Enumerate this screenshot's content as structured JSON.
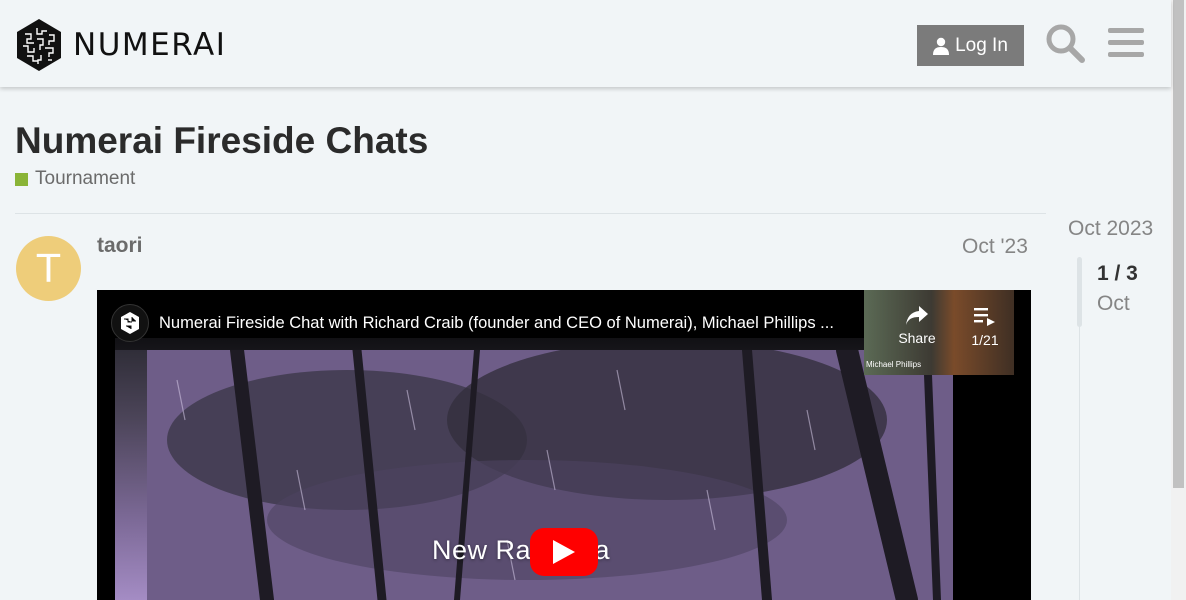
{
  "header": {
    "logo_text": "NUMERAI",
    "login_label": "Log In",
    "search_icon": "search-icon",
    "menu_icon": "hamburger-menu-icon"
  },
  "topic": {
    "title": "Numerai Fireside Chats",
    "category": "Tournament",
    "category_color": "#8ab437"
  },
  "post": {
    "avatar_letter": "T",
    "avatar_color": "#eecd7a",
    "username": "taori",
    "date": "Oct '23"
  },
  "video": {
    "title": "Numerai Fireside Chat with Richard Craib (founder and CEO of Numerai), Michael Phillips ...",
    "share_label": "Share",
    "playlist_counter": "1/21",
    "thumb_caption": "Michael Phillips",
    "caption_left": "New Ra",
    "caption_right": "ata",
    "play_color": "#ff0000"
  },
  "timeline": {
    "top_date": "Oct 2023",
    "counter": "1 / 3",
    "current_date": "Oct"
  }
}
